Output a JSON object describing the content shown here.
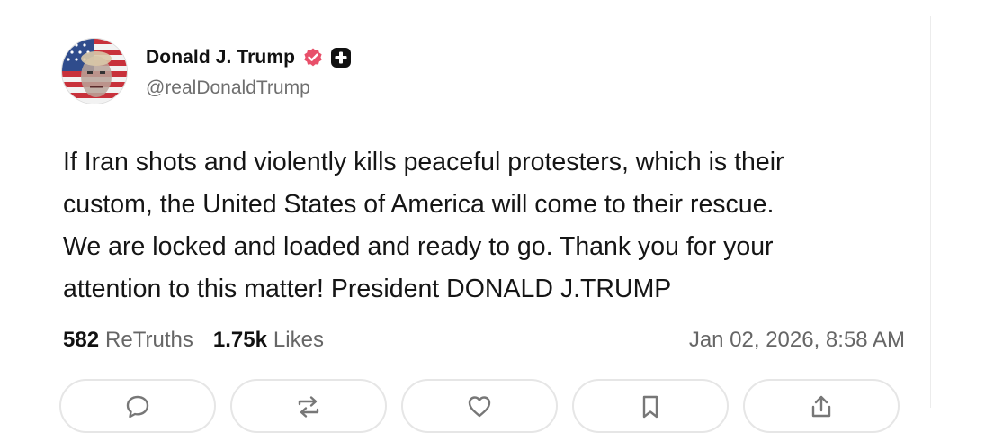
{
  "author": {
    "display_name": "Donald J. Trump",
    "handle": "@realDonaldTrump",
    "avatar_icon": "flag-portrait-avatar",
    "verified_color": "#e8506a",
    "plus_badge_color": "#111111"
  },
  "post": {
    "text": "If Iran shots and violently kills peaceful protesters, which is their\ncustom, the United States of America will come to their rescue.\nWe are locked and loaded and ready to go. Thank you for your\nattention to this matter! President DONALD J.TRUMP"
  },
  "stats": {
    "retruths_count": "582",
    "retruths_label": "ReTruths",
    "likes_count": "1.75k",
    "likes_label": "Likes",
    "timestamp": "Jan 02, 2026, 8:58 AM"
  },
  "actions": [
    {
      "icon": "reply-icon"
    },
    {
      "icon": "retruth-icon"
    },
    {
      "icon": "like-icon"
    },
    {
      "icon": "bookmark-icon"
    },
    {
      "icon": "share-icon"
    }
  ]
}
